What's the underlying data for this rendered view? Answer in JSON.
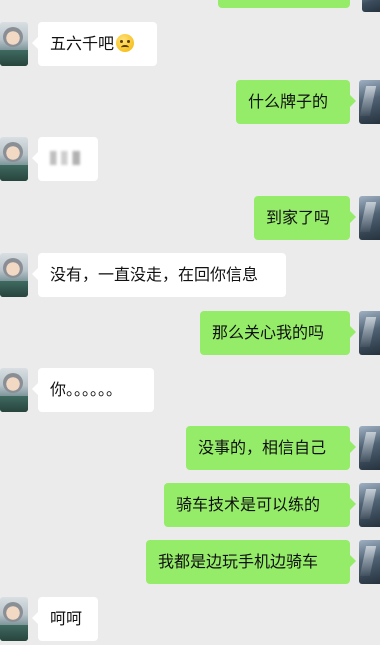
{
  "messages": [
    {
      "side": "in",
      "text": "五六千吧",
      "emoji": "smiling-sweat-emoji"
    },
    {
      "side": "out",
      "text": "什么牌子的"
    },
    {
      "side": "in",
      "text": "",
      "blurred": true
    },
    {
      "side": "out",
      "text": "到家了吗"
    },
    {
      "side": "in",
      "text": "没有，一直没走，在回你信息"
    },
    {
      "side": "out",
      "text": "那么关心我的吗"
    },
    {
      "side": "in",
      "text": "你。。。。。。"
    },
    {
      "side": "out",
      "text": "没事的，相信自己"
    },
    {
      "side": "out",
      "text": "骑车技术是可以练的"
    },
    {
      "side": "out",
      "text": "我都是边玩手机边骑车"
    },
    {
      "side": "in",
      "text": "呵呵"
    }
  ],
  "colors": {
    "background": "#ebebeb",
    "incoming_bubble": "#ffffff",
    "outgoing_bubble": "#95ec69"
  }
}
